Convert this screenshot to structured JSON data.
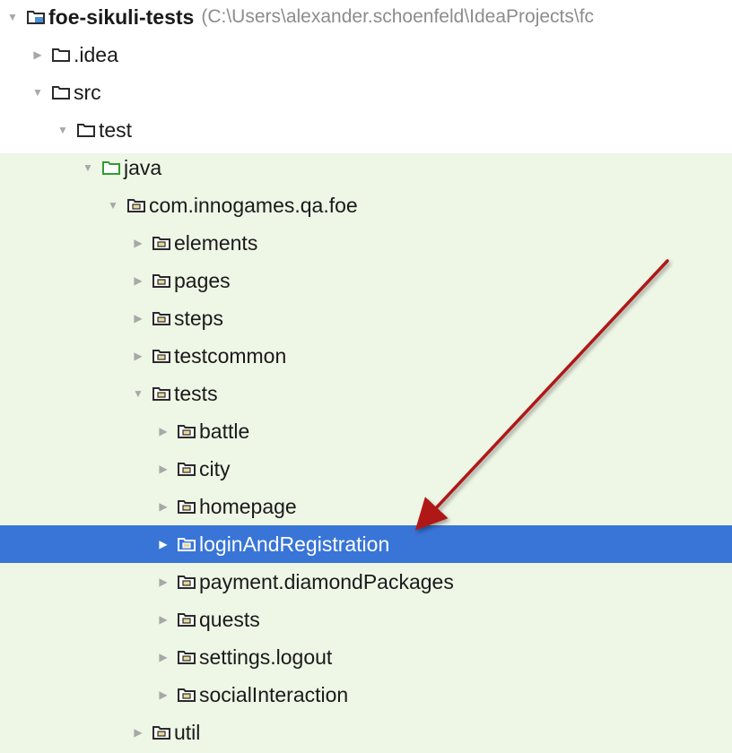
{
  "tree": {
    "rows": [
      {
        "label": "foe-sikuli-tests",
        "path": "(C:\\Users\\alexander.schoenfeld\\IdeaProjects\\fc",
        "expanded": true,
        "icon": "module-folder-icon"
      },
      {
        "label": ".idea",
        "expanded": false,
        "icon": "folder-icon"
      },
      {
        "label": "src",
        "expanded": true,
        "icon": "folder-icon"
      },
      {
        "label": "test",
        "expanded": true,
        "icon": "folder-icon"
      },
      {
        "label": "java",
        "expanded": true,
        "icon": "test-source-folder-icon"
      },
      {
        "label": "com.innogames.qa.foe",
        "expanded": true,
        "icon": "package-icon"
      },
      {
        "label": "elements",
        "expanded": false,
        "icon": "package-icon"
      },
      {
        "label": "pages",
        "expanded": false,
        "icon": "package-icon"
      },
      {
        "label": "steps",
        "expanded": false,
        "icon": "package-icon"
      },
      {
        "label": "testcommon",
        "expanded": false,
        "icon": "package-icon"
      },
      {
        "label": "tests",
        "expanded": true,
        "icon": "package-icon"
      },
      {
        "label": "battle",
        "expanded": false,
        "icon": "package-icon"
      },
      {
        "label": "city",
        "expanded": false,
        "icon": "package-icon"
      },
      {
        "label": "homepage",
        "expanded": false,
        "icon": "package-icon"
      },
      {
        "label": "loginAndRegistration",
        "expanded": false,
        "selected": true,
        "icon": "package-icon"
      },
      {
        "label": "payment.diamondPackages",
        "expanded": false,
        "icon": "package-icon"
      },
      {
        "label": "quests",
        "expanded": false,
        "icon": "package-icon"
      },
      {
        "label": "settings.logout",
        "expanded": false,
        "icon": "package-icon"
      },
      {
        "label": "socialInteraction",
        "expanded": false,
        "icon": "package-icon"
      },
      {
        "label": "util",
        "expanded": false,
        "icon": "package-icon"
      }
    ]
  },
  "colors": {
    "selection": "#3875d7",
    "test_sources_bg": "#eef6e6",
    "annotation_arrow": "#b01818",
    "folder_outline": "#2b2b2b",
    "test_folder_outline": "#2e9d2e",
    "package_fill": "#e8d89a",
    "path_text": "#8c8c8c"
  }
}
